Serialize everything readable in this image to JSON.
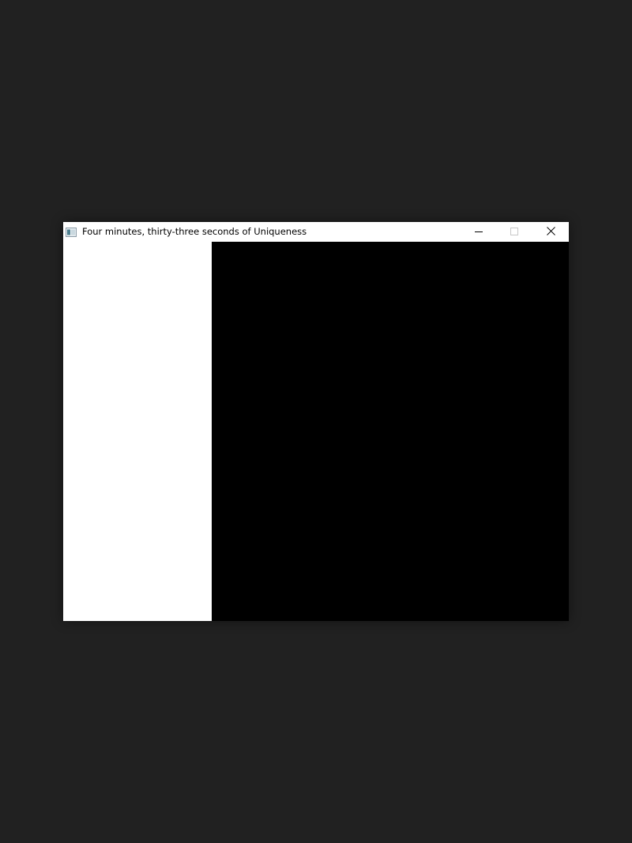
{
  "window": {
    "title": "Four minutes, thirty-three seconds of Uniqueness",
    "icon": "app-window-icon",
    "controls": {
      "minimize_icon": "minimize-icon",
      "maximize_icon": "maximize-icon",
      "close_icon": "close-icon",
      "maximize_enabled": false
    }
  },
  "colors": {
    "desktop": "#212121",
    "titlebar": "#ffffff",
    "left_pane": "#ffffff",
    "canvas": "#000000"
  }
}
